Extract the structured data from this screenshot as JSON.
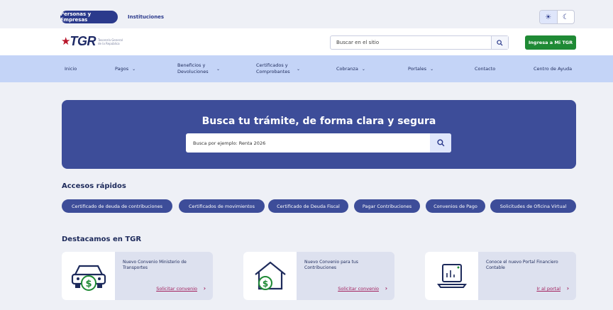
{
  "topbar": {
    "personas_label": "Personas y Empresas",
    "instituciones_label": "Instituciones",
    "theme_light_icon": "☀",
    "theme_dark_icon": "☾"
  },
  "header": {
    "logo_text": "TGR",
    "logo_sub": "Tesorería General de la República",
    "search_placeholder": "Buscar en el sitio",
    "login_label": "Ingresa a Mi TGR"
  },
  "nav": {
    "items": [
      {
        "label": "Inicio"
      },
      {
        "label": "Pagos"
      },
      {
        "label": "Beneficios y Devoluciones"
      },
      {
        "label": "Certificados y Comprobantes"
      },
      {
        "label": "Cobranza"
      },
      {
        "label": "Portales"
      },
      {
        "label": "Contacto"
      },
      {
        "label": "Centro de Ayuda"
      }
    ]
  },
  "hero": {
    "title": "Busca tu trámite, de forma clara y segura",
    "search_placeholder": "Busca por ejemplo: Renta 2026"
  },
  "quick_access": {
    "title": "Accesos rápidos",
    "chips": [
      "Certificado de deuda de contribuciones",
      "Certificados de movimientos",
      "Certificado de Deuda Fiscal",
      "Pagar Contribuciones",
      "Convenios de Pago",
      "Solicitudes de Oficina Virtual"
    ]
  },
  "featured": {
    "title": "Destacamos en TGR",
    "cards": [
      {
        "text": "Nuevo Convenio Ministerio de Transportes",
        "link": "Solicitar convenio",
        "icon": "car-money-icon"
      },
      {
        "text": "Nuevo Convenio para tus Contribuciones",
        "link": "Solicitar convenio",
        "icon": "house-money-icon"
      },
      {
        "text": "Conoce el nuevo Portal Financiero Contable",
        "link": "Ir al portal",
        "icon": "monitor-chart-icon"
      }
    ]
  },
  "colors": {
    "primary": "#3d4d99",
    "nav_bg": "#c4d4f7",
    "login_green": "#1f8a35",
    "link": "#a3215e",
    "logo_red": "#b8152a"
  }
}
